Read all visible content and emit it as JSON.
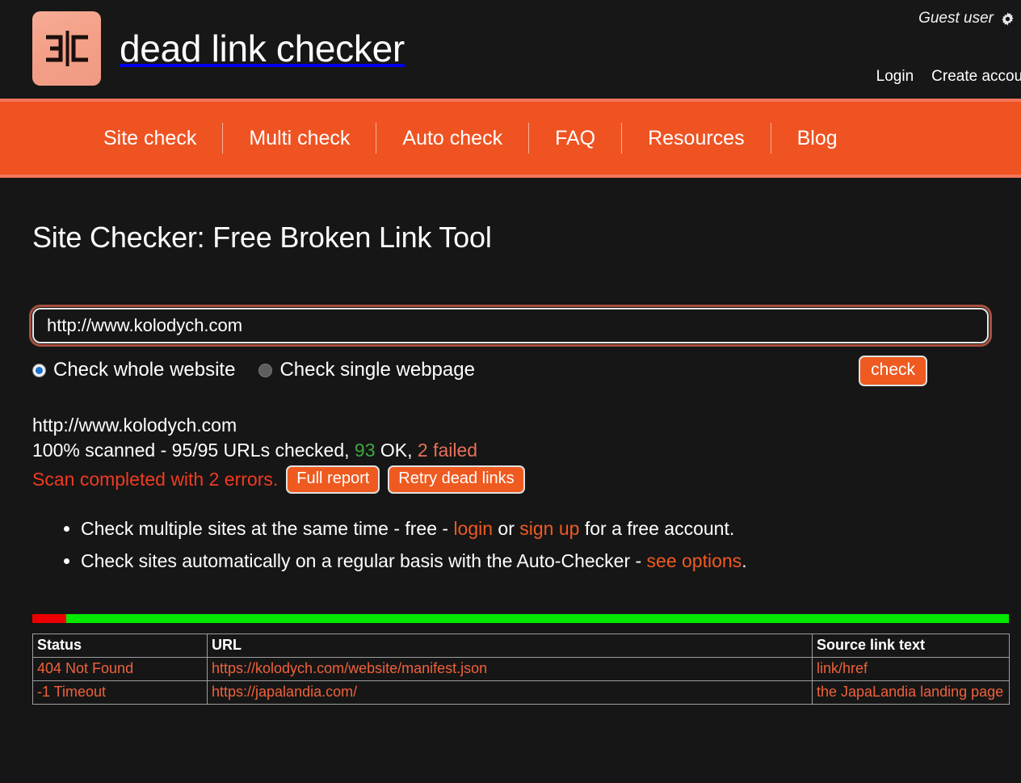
{
  "header": {
    "logo_icon": "dead-link-checker-logo",
    "brand_title": "dead link checker",
    "guest_label": "Guest user",
    "guest_icon": "gear-icon",
    "login_label": "Login",
    "create_account_label": "Create account"
  },
  "nav": {
    "items": [
      {
        "label": "Site check"
      },
      {
        "label": "Multi check"
      },
      {
        "label": "Auto check"
      },
      {
        "label": "FAQ"
      },
      {
        "label": "Resources"
      },
      {
        "label": "Blog"
      }
    ]
  },
  "main": {
    "page_title": "Site Checker: Free Broken Link Tool",
    "url_input": {
      "value": "http://www.kolodych.com",
      "placeholder": "http://www.kolodych.com"
    },
    "scope_options": [
      {
        "label": "Check whole website",
        "selected": true
      },
      {
        "label": "Check single webpage",
        "selected": false
      }
    ],
    "check_button_label": "check"
  },
  "results": {
    "url": "http://www.kolodych.com",
    "stats_prefix": "100% scanned - 95/95 URLs checked,",
    "ok_count": "93",
    "ok_suffix": "OK,",
    "failed_text": "2 failed",
    "scan_message": "Scan completed with 2 errors.",
    "full_report_label": "Full report",
    "retry_label": "Retry dead links",
    "progress": {
      "percent_scanned": 100,
      "failed_percent": 3.5,
      "ok_color": "#00ea00",
      "fail_color": "#ee0000"
    }
  },
  "promos": {
    "item1": {
      "pre": "Check multiple sites at the same time - free - ",
      "link1": "login",
      "mid": " or ",
      "link2": "sign up",
      "post": " for a free account."
    },
    "item2": {
      "pre": "Check sites automatically on a regular basis with the Auto-Checker - ",
      "link1": "see options",
      "post": "."
    }
  },
  "table": {
    "columns": [
      "Status",
      "URL",
      "Source link text"
    ],
    "rows": [
      {
        "status": "404 Not Found",
        "url": "https://kolodych.com/website/manifest.json",
        "source": "link/href"
      },
      {
        "status": "-1 Timeout",
        "url": "https://japalandia.com/",
        "source": "the JapaLandia landing page"
      }
    ]
  },
  "colors": {
    "accent": "#ef5322",
    "accent_light": "#f4745a",
    "logo_bg": "#f4a088",
    "error": "#f03b20",
    "ok": "#3fa83f",
    "page_bg": "#161616"
  }
}
